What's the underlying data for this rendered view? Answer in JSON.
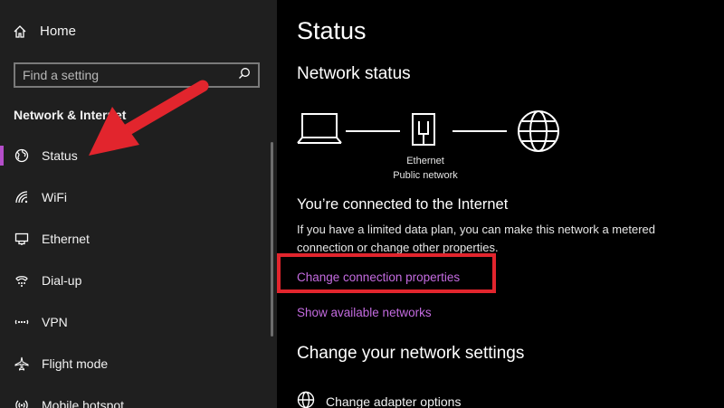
{
  "sidebar": {
    "home_label": "Home",
    "search_placeholder": "Find a setting",
    "section_title": "Network & Internet",
    "items": [
      {
        "label": "Status",
        "icon": "globe-status-icon"
      },
      {
        "label": "WiFi",
        "icon": "wifi-icon"
      },
      {
        "label": "Ethernet",
        "icon": "ethernet-icon"
      },
      {
        "label": "Dial-up",
        "icon": "dial-up-icon"
      },
      {
        "label": "VPN",
        "icon": "vpn-icon"
      },
      {
        "label": "Flight mode",
        "icon": "airplane-icon"
      },
      {
        "label": "Mobile hotspot",
        "icon": "hotspot-icon"
      }
    ],
    "active_item": "Status"
  },
  "main": {
    "page_title": "Status",
    "network_status_heading": "Network status",
    "diagram": {
      "adapter_name": "Ethernet",
      "network_type": "Public network"
    },
    "connected_heading": "You’re connected to the Internet",
    "description": "If you have a limited data plan, you can make this network a metered connection or change other properties.",
    "change_connection_link": "Change connection properties",
    "show_networks_link": "Show available networks",
    "change_settings_heading": "Change your network settings",
    "adapter_options_label": "Change adapter options"
  },
  "colors": {
    "accent": "#c46be0",
    "active_indicator": "#b44ec9",
    "annotation_red": "#e2252d",
    "sidebar_bg": "#1f1f1f",
    "main_bg": "#000000"
  }
}
